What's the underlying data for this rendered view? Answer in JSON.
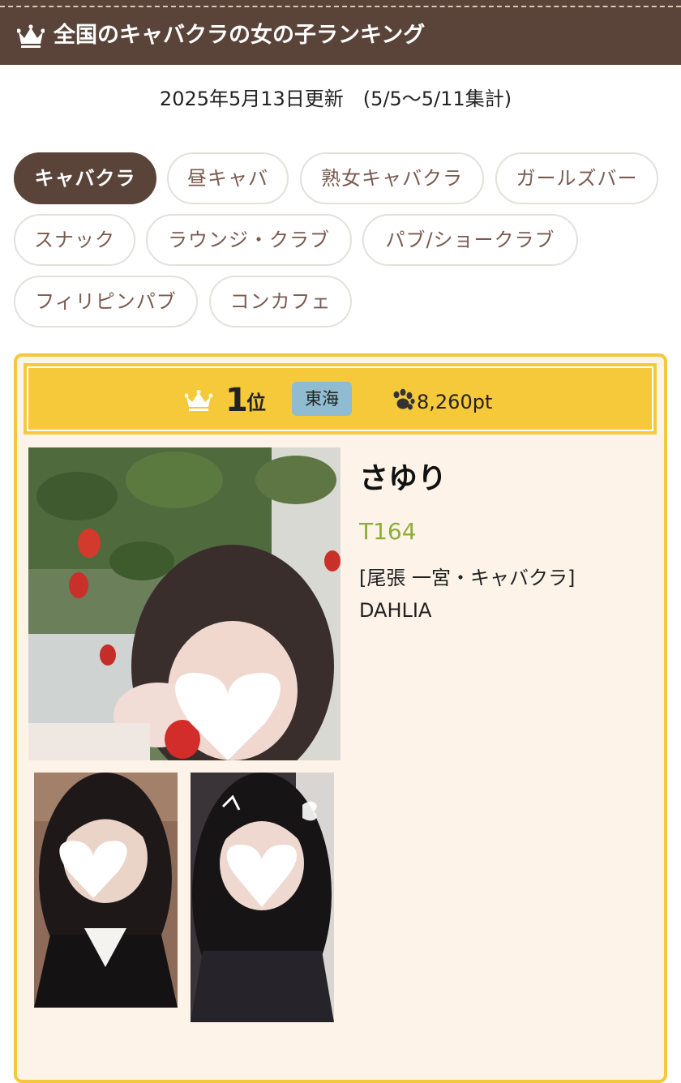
{
  "header": {
    "title": "全国のキャバクラの女の子ランキング",
    "icon": "crown-icon"
  },
  "update": {
    "text": "2025年5月13日更新　(5/5～5/11集計)"
  },
  "tabs": [
    {
      "label": "キャバクラ",
      "active": true
    },
    {
      "label": "昼キャバ",
      "active": false
    },
    {
      "label": "熟女キャバクラ",
      "active": false
    },
    {
      "label": "ガールズバー",
      "active": false
    },
    {
      "label": "スナック",
      "active": false
    },
    {
      "label": "ラウンジ・クラブ",
      "active": false
    },
    {
      "label": "パブ/ショークラブ",
      "active": false
    },
    {
      "label": "フィリピンパブ",
      "active": false
    },
    {
      "label": "コンカフェ",
      "active": false
    }
  ],
  "ranking": {
    "rank_number": "1",
    "rank_suffix": "位",
    "region": "東海",
    "points": "8,260pt",
    "name": "さゆり",
    "height": "T164",
    "area": "[尾張 一宮・キャバクラ]",
    "shop": "DAHLIA"
  },
  "colors": {
    "header_bg": "#5a4439",
    "accent_gold": "#f6c93a",
    "card_bg": "#fdf3e8",
    "height_green": "#8bad3a",
    "region_badge": "#8fbcd0"
  }
}
